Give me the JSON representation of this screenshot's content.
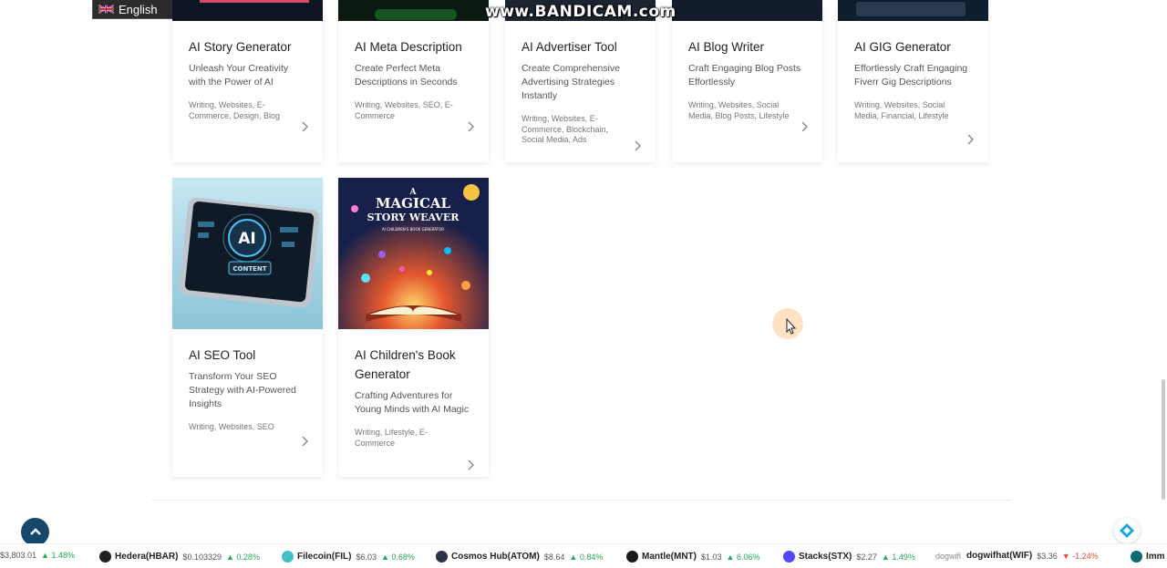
{
  "language": {
    "label": "English"
  },
  "watermark": "www.BANDICAM.com",
  "cards_row1": [
    {
      "title": "AI Story Generator",
      "desc": "Unleash Your Creativity with the Power of AI",
      "tags": "Writing, Websites, E-Commerce, Design, Blog"
    },
    {
      "title": "AI Meta Description",
      "desc": "Create Perfect Meta Descriptions in Seconds",
      "tags": "Writing, Websites, SEO, E-Commerce"
    },
    {
      "title": "AI Advertiser Tool",
      "desc": "Create Comprehensive Advertising Strategies Instantly",
      "tags": "Writing, Websites, E-Commerce, Blockchain, Social Media, Ads"
    },
    {
      "title": "AI Blog Writer",
      "desc": "Craft Engaging Blog Posts Effortlessly",
      "tags": "Writing, Websites, Social Media, Blog Posts, Lifestyle"
    },
    {
      "title": "AI GIG Generator",
      "desc": "Effortlessly Craft Engaging Fiverr Gig Descriptions",
      "tags": "Writing, Websites, Social Media, Financial, Lifestyle"
    }
  ],
  "cards_row2": [
    {
      "title": "AI SEO Tool",
      "desc": "Transform Your SEO Strategy with AI-Powered Insights",
      "tags": "Writing, Websites, SEO",
      "image_text": {
        "center": "AI",
        "badge": "CONTENT"
      }
    },
    {
      "title": "AI Children's Book Generator",
      "desc": "Crafting Adventures for Young Minds with AI Magic",
      "tags": "Writing, Lifestyle, E-Commerce",
      "image_text": {
        "line1": "A",
        "line2": "MAGICAL",
        "line3": "STORY WEAVER",
        "sub": "AI CHILDREN'S BOOK GENERATOR"
      }
    }
  ],
  "ticker": [
    {
      "name": "",
      "price": "$3,803.01",
      "change": "1.48%",
      "dir": "up",
      "color": "#627eea"
    },
    {
      "name": "Hedera(HBAR)",
      "price": "$0.103329",
      "change": "0.28%",
      "dir": "up",
      "color": "#222222"
    },
    {
      "name": "Filecoin(FIL)",
      "price": "$6.03",
      "change": "0.68%",
      "dir": "up",
      "color": "#42c1ca"
    },
    {
      "name": "Cosmos Hub(ATOM)",
      "price": "$8.64",
      "change": "0.84%",
      "dir": "up",
      "color": "#2e3148"
    },
    {
      "name": "Mantle(MNT)",
      "price": "$1.03",
      "change": "6.06%",
      "dir": "up",
      "color": "#1a1a1a"
    },
    {
      "name": "Stacks(STX)",
      "price": "$2.27",
      "change": "1.49%",
      "dir": "up",
      "color": "#5546ff"
    },
    {
      "name": "dogwifhat(WIF)",
      "price": "$3.36",
      "change": "-1.24%",
      "dir": "down",
      "color": "#c9a27a",
      "alt": "dogwifi"
    },
    {
      "name": "Imm",
      "price": "",
      "change": "",
      "dir": "up",
      "color": "#0b6b73"
    }
  ]
}
